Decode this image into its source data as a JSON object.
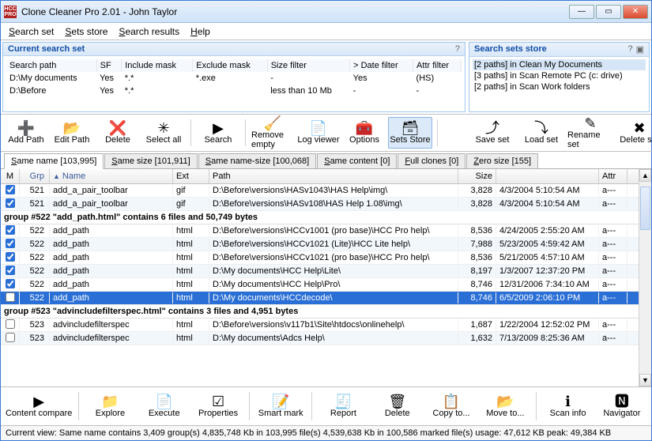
{
  "titlebar": {
    "icon_text": "HCC\nPRO",
    "title": "Clone Cleaner Pro 2.01 - John Taylor"
  },
  "menu": [
    "Search set",
    "Sets store",
    "Search results",
    "Help"
  ],
  "panels": {
    "left_title": "Current search set",
    "right_title": "Search sets store",
    "sp_cols": [
      "Search path",
      "SF",
      "Include mask",
      "Exclude mask",
      "Size filter",
      "> Date filter",
      "Attr filter"
    ],
    "sp_rows": [
      [
        "D:\\My documents",
        "Yes",
        "*.*",
        "*.exe",
        "-",
        "Yes",
        "(HS)"
      ],
      [
        "D:\\Before",
        "Yes",
        "*.*",
        "",
        "less than 10 Mb",
        "-",
        "-"
      ]
    ],
    "sets": [
      "[2 paths] in Clean My Documents",
      "[3 paths] in Scan Remote PC (c: drive)",
      "[2 paths] in Scan Work folders"
    ]
  },
  "topbar": {
    "left": [
      {
        "label": "Add Path",
        "icon": "➕",
        "name": "add-path-button"
      },
      {
        "label": "Edit Path",
        "icon": "📂",
        "name": "edit-path-button"
      },
      {
        "label": "Delete",
        "icon": "❌",
        "name": "delete-path-button"
      },
      {
        "label": "Select all",
        "icon": "✳",
        "name": "select-all-button"
      },
      {
        "label": "Search",
        "icon": "▶",
        "name": "search-button"
      },
      {
        "label": "Remove empty",
        "icon": "🧹",
        "name": "remove-empty-button"
      },
      {
        "label": "Log viewer",
        "icon": "📄",
        "name": "log-viewer-button"
      },
      {
        "label": "Options",
        "icon": "🧰",
        "name": "options-button"
      },
      {
        "label": "Sets Store",
        "icon": "🗃",
        "name": "sets-store-button",
        "active": true
      }
    ],
    "right": [
      {
        "label": "Save set",
        "icon": "⤴",
        "name": "save-set-button"
      },
      {
        "label": "Load set",
        "icon": "⤵",
        "name": "load-set-button"
      },
      {
        "label": "Rename set",
        "icon": "✎",
        "name": "rename-set-button"
      },
      {
        "label": "Delete set",
        "icon": "✖",
        "name": "delete-set-button"
      }
    ]
  },
  "tabs": [
    {
      "label": "Same name [103,995]",
      "active": true
    },
    {
      "label": "Same size [101,911]"
    },
    {
      "label": "Same name-size [100,068]"
    },
    {
      "label": "Same content [0]"
    },
    {
      "label": "Full clones [0]"
    },
    {
      "label": "Zero size [155]"
    }
  ],
  "grid": {
    "cols": {
      "m": "M",
      "grp": "Grp",
      "name": "Name",
      "ext": "Ext",
      "path": "Path",
      "size": "Size",
      "date": "",
      "attr": "Attr"
    },
    "rows": [
      {
        "type": "row",
        "alt": false,
        "m": true,
        "grp": "521",
        "name": "add_a_pair_toolbar",
        "ext": "gif",
        "path": "D:\\Before\\versions\\HASv1043\\HAS Help\\img\\",
        "size": "3,828",
        "date": "4/3/2004 5:10:54 AM",
        "attr": "a---"
      },
      {
        "type": "row",
        "alt": true,
        "m": true,
        "grp": "521",
        "name": "add_a_pair_toolbar",
        "ext": "gif",
        "path": "D:\\Before\\versions\\HASv108\\HAS Help 1.08\\img\\",
        "size": "3,828",
        "date": "4/3/2004 5:10:54 AM",
        "attr": "a---"
      },
      {
        "type": "group",
        "text": "group #522 \"add_path.html\" contains 6 files and 50,749 bytes"
      },
      {
        "type": "row",
        "alt": false,
        "m": true,
        "grp": "522",
        "name": "add_path",
        "ext": "html",
        "path": "D:\\Before\\versions\\HCCv1001 (pro base)\\HCC Pro help\\",
        "size": "8,536",
        "date": "4/24/2005 2:55:20 AM",
        "attr": "a---"
      },
      {
        "type": "row",
        "alt": true,
        "m": true,
        "grp": "522",
        "name": "add_path",
        "ext": "html",
        "path": "D:\\Before\\versions\\HCCv1021 (Lite)\\HCC Lite help\\",
        "size": "7,988",
        "date": "5/23/2005 4:59:42 AM",
        "attr": "a---"
      },
      {
        "type": "row",
        "alt": false,
        "m": true,
        "grp": "522",
        "name": "add_path",
        "ext": "html",
        "path": "D:\\Before\\versions\\HCCv1021 (pro base)\\HCC Pro help\\",
        "size": "8,536",
        "date": "5/21/2005 4:57:10 AM",
        "attr": "a---"
      },
      {
        "type": "row",
        "alt": true,
        "m": true,
        "grp": "522",
        "name": "add_path",
        "ext": "html",
        "path": "D:\\My documents\\HCC Help\\Lite\\",
        "size": "8,197",
        "date": "1/3/2007 12:37:20 PM",
        "attr": "a---"
      },
      {
        "type": "row",
        "alt": false,
        "m": true,
        "grp": "522",
        "name": "add_path",
        "ext": "html",
        "path": "D:\\My documents\\HCC Help\\Pro\\",
        "size": "8,746",
        "date": "12/31/2006 7:34:10 AM",
        "attr": "a---"
      },
      {
        "type": "row",
        "alt": true,
        "m": false,
        "sel": true,
        "grp": "522",
        "name": "add_path",
        "ext": "html",
        "path": "D:\\My documents\\HCCdecode\\",
        "size": "8,746",
        "date": "6/5/2009 2:06:10 PM",
        "attr": "a---"
      },
      {
        "type": "group",
        "text": "group #523 \"advincludefilterspec.html\" contains 3 files and 4,951 bytes"
      },
      {
        "type": "row",
        "alt": false,
        "m": false,
        "grp": "523",
        "name": "advincludefilterspec",
        "ext": "html",
        "path": "D:\\Before\\versions\\v117b1\\Site\\htdocs\\onlinehelp\\",
        "size": "1,687",
        "date": "1/22/2004 12:52:02 PM",
        "attr": "a---"
      },
      {
        "type": "row",
        "alt": true,
        "m": false,
        "grp": "523",
        "name": "advincludefilterspec",
        "ext": "html",
        "path": "D:\\My documents\\Adcs Help\\",
        "size": "1,632",
        "date": "7/13/2009 8:25:36 AM",
        "attr": "a---"
      }
    ]
  },
  "bottom": [
    {
      "label": "Content compare",
      "icon": "▶",
      "wide": true,
      "name": "content-compare-button"
    },
    {
      "label": "Explore",
      "icon": "📁",
      "name": "explore-button"
    },
    {
      "label": "Execute",
      "icon": "📄",
      "name": "execute-button"
    },
    {
      "label": "Properties",
      "icon": "☑",
      "name": "properties-button"
    },
    {
      "label": "Smart mark",
      "icon": "📝",
      "name": "smart-mark-button"
    },
    {
      "label": "Report",
      "icon": "🧾",
      "name": "report-button"
    },
    {
      "label": "Delete",
      "icon": "🗑",
      "name": "delete-row-button"
    },
    {
      "label": "Copy to...",
      "icon": "📋",
      "name": "copy-to-button"
    },
    {
      "label": "Move to...",
      "icon": "📂",
      "name": "move-to-button"
    },
    {
      "label": "Scan info",
      "icon": "ℹ",
      "name": "scan-info-button"
    },
    {
      "label": "Navigator",
      "icon": "🅽",
      "name": "navigator-button"
    }
  ],
  "status": "Current view: Same name contains 3,409 group(s)   4,835,748 Kb in 103,995 file(s)   4,539,638 Kb in 100,586 marked file(s) usage: 47,612 KB peak: 49,384 KB"
}
